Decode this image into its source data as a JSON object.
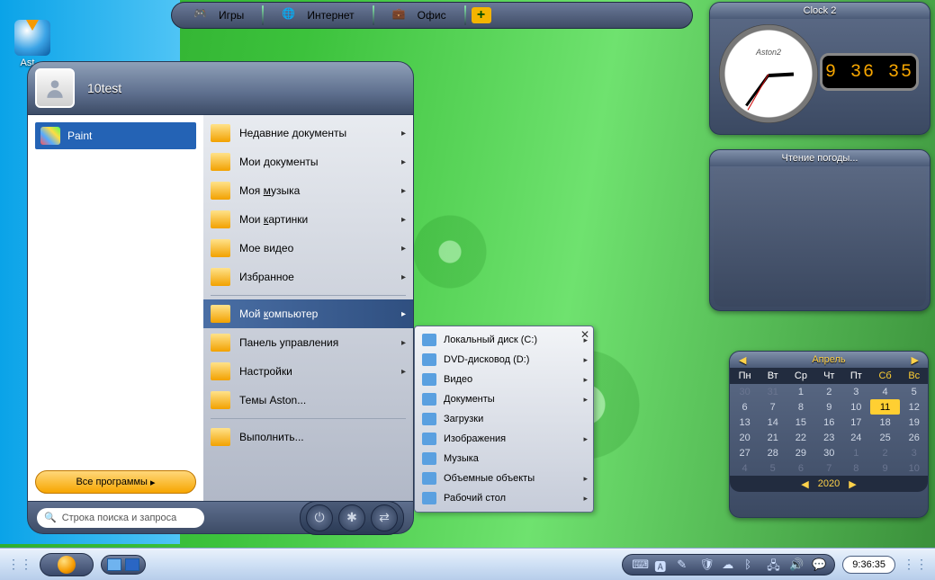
{
  "topdock": {
    "items": [
      {
        "label": "Игры",
        "icon": "gamepad"
      },
      {
        "label": "Интернет",
        "icon": "globe"
      },
      {
        "label": "Офис",
        "icon": "briefcase"
      }
    ]
  },
  "desktop_icons": [
    {
      "label": "Ast…"
    }
  ],
  "clock_widget": {
    "title": "Clock 2",
    "brand": "Aston2",
    "digital": "9 36 35"
  },
  "weather_widget": {
    "title": "Чтение погоды..."
  },
  "calendar": {
    "month": "Апрель",
    "year": "2020",
    "weekdays": [
      "Пн",
      "Вт",
      "Ср",
      "Чт",
      "Пт",
      "Сб",
      "Вс"
    ],
    "rows": [
      [
        {
          "d": "30",
          "dim": true
        },
        {
          "d": "31",
          "dim": true
        },
        {
          "d": "1"
        },
        {
          "d": "2"
        },
        {
          "d": "3"
        },
        {
          "d": "4"
        },
        {
          "d": "5"
        }
      ],
      [
        {
          "d": "6"
        },
        {
          "d": "7"
        },
        {
          "d": "8"
        },
        {
          "d": "9"
        },
        {
          "d": "10"
        },
        {
          "d": "11",
          "today": true
        },
        {
          "d": "12"
        }
      ],
      [
        {
          "d": "13"
        },
        {
          "d": "14"
        },
        {
          "d": "15"
        },
        {
          "d": "16"
        },
        {
          "d": "17"
        },
        {
          "d": "18"
        },
        {
          "d": "19"
        }
      ],
      [
        {
          "d": "20"
        },
        {
          "d": "21"
        },
        {
          "d": "22"
        },
        {
          "d": "23"
        },
        {
          "d": "24"
        },
        {
          "d": "25"
        },
        {
          "d": "26"
        }
      ],
      [
        {
          "d": "27"
        },
        {
          "d": "28"
        },
        {
          "d": "29"
        },
        {
          "d": "30"
        },
        {
          "d": "1",
          "dim": true
        },
        {
          "d": "2",
          "dim": true
        },
        {
          "d": "3",
          "dim": true
        }
      ],
      [
        {
          "d": "4",
          "dim": true
        },
        {
          "d": "5",
          "dim": true
        },
        {
          "d": "6",
          "dim": true
        },
        {
          "d": "7",
          "dim": true
        },
        {
          "d": "8",
          "dim": true
        },
        {
          "d": "9",
          "dim": true
        },
        {
          "d": "10",
          "dim": true
        }
      ]
    ]
  },
  "start_menu": {
    "username": "10test",
    "pinned": [
      {
        "label": "Paint"
      }
    ],
    "all_programs": "Все программы",
    "right_items": [
      {
        "label": "Недавние документы",
        "sub": true
      },
      {
        "label": "Мои документы",
        "sub": true
      },
      {
        "label": "Моя музыка",
        "sub": true,
        "accel": 1
      },
      {
        "label": "Мои картинки",
        "sub": true,
        "accel": 1
      },
      {
        "label": "Мое видео",
        "sub": true
      },
      {
        "label": "Избранное",
        "sub": true
      },
      {
        "sep": true
      },
      {
        "label": "Мой компьютер",
        "sub": true,
        "selected": true,
        "accel": 1
      },
      {
        "label": "Панель управления",
        "sub": true
      },
      {
        "label": "Настройки",
        "sub": true
      },
      {
        "label": "Темы Aston..."
      },
      {
        "sep": true
      },
      {
        "label": "Выполнить..."
      }
    ],
    "search_placeholder": "Строка поиска и запроса"
  },
  "flyout": {
    "items": [
      {
        "label": "Локальный диск (C:)",
        "sub": true
      },
      {
        "label": "DVD-дисковод (D:)",
        "sub": true
      },
      {
        "label": "Видео",
        "sub": true
      },
      {
        "label": "Документы",
        "sub": true
      },
      {
        "label": "Загрузки"
      },
      {
        "label": "Изображения",
        "sub": true
      },
      {
        "label": "Музыка"
      },
      {
        "label": "Объемные объекты",
        "sub": true
      },
      {
        "label": "Рабочий стол",
        "sub": true
      }
    ]
  },
  "taskbar": {
    "clock": "9:36:35",
    "tray_icons": [
      "keyboard-icon",
      "keyboard-layout-icon",
      "pen-icon",
      "shield-icon",
      "onedrive-icon",
      "bluetooth-icon",
      "network-icon",
      "volume-icon",
      "action-center-icon"
    ]
  }
}
